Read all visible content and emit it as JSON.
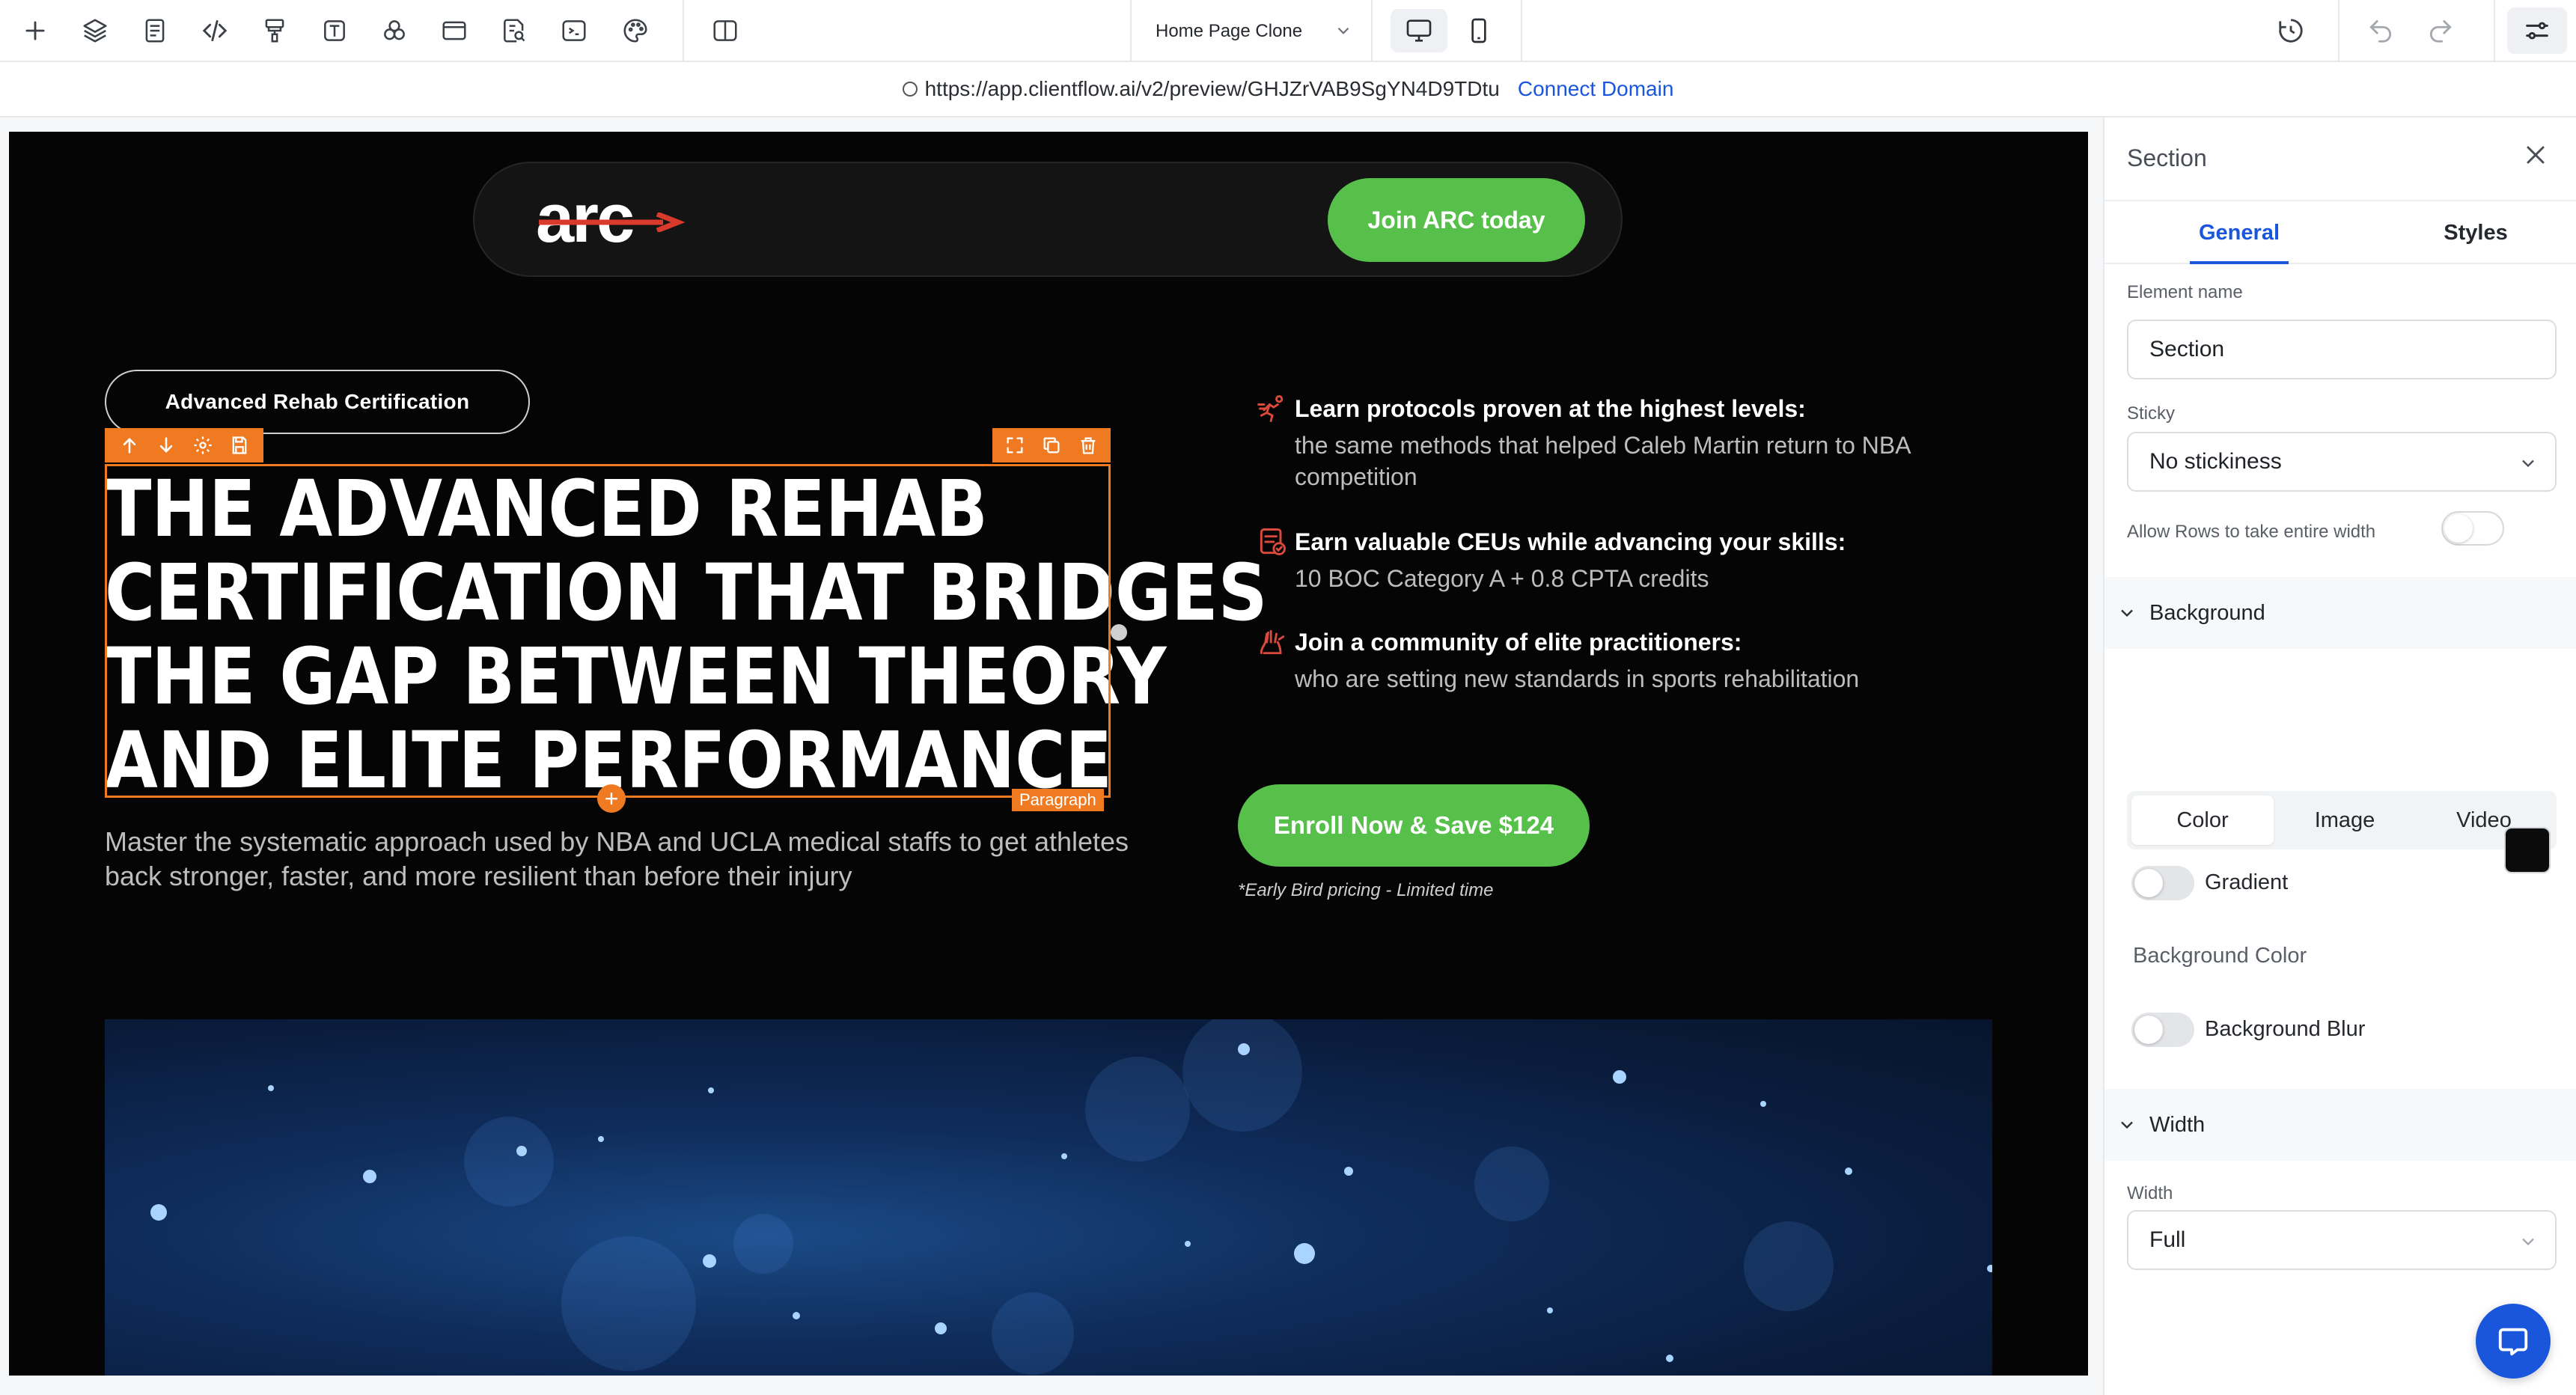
{
  "toolbar": {
    "icons": [
      "plus-icon",
      "layers-icon",
      "page-icon",
      "code-icon",
      "paint-roller-icon",
      "text-icon",
      "components-icon",
      "window-icon",
      "search-page-icon",
      "terminal-icon",
      "palette-icon",
      "split-view-icon"
    ],
    "page_name": "Home Page Clone",
    "history_icon": "history-icon",
    "undo_icon": "undo-icon",
    "redo_icon": "redo-icon",
    "settings_icon": "sliders-icon"
  },
  "urlbar": {
    "url": "https://app.clientflow.ai/v2/preview/GHJZrVAB9SgYN4D9TDtu",
    "connect_label": "Connect Domain"
  },
  "site": {
    "logo_text": "arc",
    "join_label": "Join ARC today",
    "cert_pill": "Advanced Rehab Certification",
    "headline_lines": [
      "THE ADVANCED REHAB",
      "CERTIFICATION THAT BRIDGES",
      "THE GAP BETWEEN THEORY",
      "AND ELITE PERFORMANCE"
    ],
    "selection_tag": "Paragraph",
    "subhead": "Master the systematic approach used by NBA and UCLA medical staffs to get athletes back stronger, faster, and more resilient than before their injury",
    "features": [
      {
        "icon": "sprint-icon",
        "title": "Learn protocols proven at the highest levels:",
        "desc": "the same methods that helped Caleb Martin return to NBA competition"
      },
      {
        "icon": "certificate-icon",
        "title": "Earn valuable CEUs while advancing your skills:",
        "desc": "10 BOC Category A + 0.8 CPTA credits"
      },
      {
        "icon": "community-hands-icon",
        "title": "Join a community of elite practitioners:",
        "desc": "who are setting new standards in sports rehabilitation"
      }
    ],
    "enroll_label": "Enroll Now & Save $124",
    "early_note": "*Early Bird pricing - Limited time"
  },
  "panel": {
    "title": "Section",
    "tabs": {
      "general": "General",
      "styles": "Styles"
    },
    "element_name_label": "Element name",
    "element_name_value": "Section",
    "sticky_label": "Sticky",
    "sticky_value": "No stickiness",
    "allow_rows_label": "Allow Rows to take entire width",
    "background_heading": "Background",
    "bg_tabs": {
      "color": "Color",
      "image": "Image",
      "video": "Video"
    },
    "gradient_label": "Gradient",
    "bg_color_label": "Background Color",
    "bg_blur_label": "Background Blur",
    "width_heading": "Width",
    "width_label": "Width",
    "width_value": "Full"
  },
  "colors": {
    "accent_green": "#57c04a",
    "selection_orange": "#f07a22",
    "link_blue": "#1a56db",
    "icon_red": "#d84a3b",
    "bg_swatch": "#0b0b0b"
  }
}
